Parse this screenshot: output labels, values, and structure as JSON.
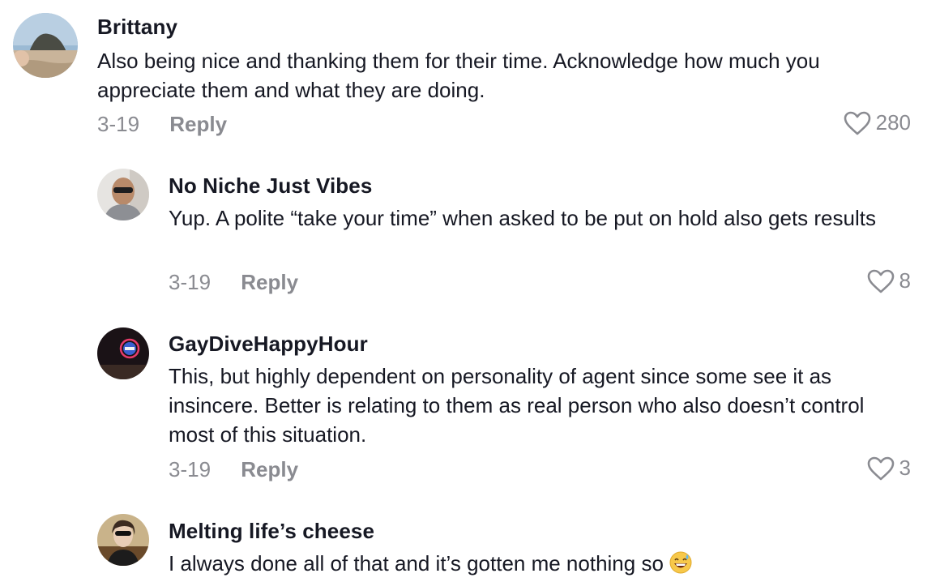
{
  "comments": [
    {
      "username": "Brittany",
      "text": "Also being nice and thanking them for their time. Acknowledge how much you appreciate them and what they are doing.",
      "date": "3-19",
      "reply_label": "Reply",
      "likes": "280",
      "avatar_icon": "avatar-beach-rock"
    },
    {
      "username": "No Niche Just Vibes",
      "text": "Yup. A polite “take your time” when asked to be put on hold also gets results",
      "date": "3-19",
      "reply_label": "Reply",
      "likes": "8",
      "avatar_icon": "avatar-man-sunglasses"
    },
    {
      "username": "GayDiveHappyHour",
      "text": "This, but highly dependent on personality of agent since some see it as insincere. Better is relating to them as real person who also doesn’t control most of this situation.",
      "date": "3-19",
      "reply_label": "Reply",
      "likes": "3",
      "avatar_icon": "avatar-neon-sign"
    },
    {
      "username": "Melting life’s cheese",
      "text": "I always done all of that and it’s gotten me nothing so",
      "emoji": "grinning-sweat-emoji",
      "avatar_icon": "avatar-woman-sunglasses"
    }
  ],
  "colors": {
    "primary_text": "#161823",
    "secondary_text": "#8a8b91",
    "background": "#ffffff"
  }
}
